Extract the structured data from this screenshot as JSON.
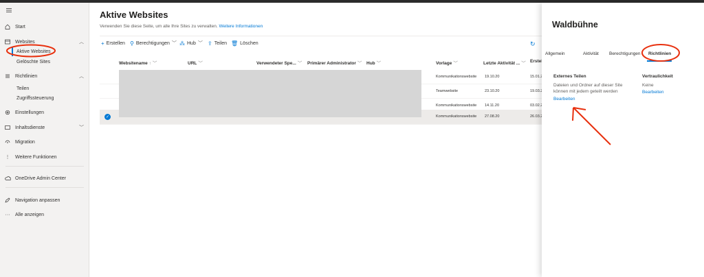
{
  "sidebar": {
    "items": [
      {
        "label": "Start",
        "icon": "home-icon"
      },
      {
        "label": "Websites",
        "icon": "websites-icon"
      },
      {
        "label": "Richtlinien",
        "icon": "policies-icon"
      },
      {
        "label": "Einstellungen",
        "icon": "gear-icon"
      },
      {
        "label": "Inhaltsdienste",
        "icon": "content-services-icon"
      },
      {
        "label": "Migration",
        "icon": "migration-icon"
      },
      {
        "label": "Weitere Funktionen",
        "icon": "more-features-icon"
      },
      {
        "label": "OneDrive Admin Center",
        "icon": "onedrive-icon"
      },
      {
        "label": "Navigation anpassen",
        "icon": "edit-icon"
      },
      {
        "label": "Alle anzeigen",
        "icon": "more-icon"
      }
    ],
    "sub_websites": [
      "Aktive Websites",
      "Gelöschte Sites"
    ],
    "sub_policies": [
      "Teilen",
      "Zugriffssteuerung"
    ]
  },
  "main": {
    "title": "Aktive Websites",
    "description": "Verwenden Sie diese Seite, um alle Ihre Sites zu verwalten.",
    "description_link": "Weitere Informationen",
    "commands": [
      "Erstellen",
      "Berechtigungen",
      "Hub",
      "Teilen",
      "Löschen"
    ],
    "columns": [
      "Websitename",
      "URL",
      "Verwendeter Spe...",
      "Primärer Administrator",
      "Hub",
      "Vorlage",
      "Letzte Aktivität ...",
      "Erstel"
    ],
    "rows": [
      {
        "vorlage": "Kommunikationswebsite",
        "letzte": "19.10.20",
        "erstellt": "15.01.2"
      },
      {
        "vorlage": "Teamwebsite",
        "letzte": "23.10.20",
        "erstellt": "19.03.2"
      },
      {
        "vorlage": "Kommunikationswebsite",
        "letzte": "14.11.20",
        "erstellt": "03.02.2"
      },
      {
        "vorlage": "Kommunikationswebsite",
        "letzte": "27.08.20",
        "erstellt": "26.03.2"
      }
    ]
  },
  "panel": {
    "title": "Waldbühne",
    "tabs": [
      "Allgemein",
      "Aktivität",
      "Berechtigungen",
      "Richtlinien"
    ],
    "external_heading": "Externes Teilen",
    "external_text_1": "Dateien und Ordner auf dieser Site",
    "external_text_2": "können mit jedem geteilt werden",
    "external_link": "Bearbeiten",
    "confidential_heading": "Vertraulichkeit",
    "confidential_value": "Keine",
    "confidential_link": "Bearbeiten"
  },
  "colors": {
    "accent": "#0078d4",
    "annotation": "#e8300e"
  }
}
